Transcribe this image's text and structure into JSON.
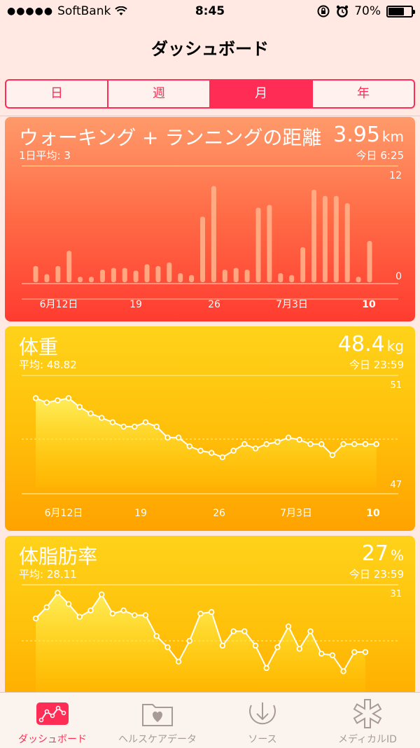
{
  "status": {
    "carrier": "SoftBank",
    "time": "8:45",
    "battery": "70%",
    "battery_level": 0.7
  },
  "nav": {
    "title": "ダッシュボード"
  },
  "segments": [
    {
      "label": "日",
      "active": false
    },
    {
      "label": "週",
      "active": false
    },
    {
      "label": "月",
      "active": true
    },
    {
      "label": "年",
      "active": false
    }
  ],
  "cards": {
    "distance": {
      "title": "ウォーキング + ランニングの距離",
      "value": "3.95",
      "unit": "km",
      "sub": "1日平均: 3",
      "time": "今日 6:25"
    },
    "weight": {
      "title": "体重",
      "value": "48.4",
      "unit": "kg",
      "sub": "平均: 48.82",
      "time": "今日 23:59"
    },
    "fat": {
      "title": "体脂肪率",
      "value": "27",
      "unit": "%",
      "sub": "平均: 28.11",
      "time": "今日 23:59"
    }
  },
  "chart_data": [
    {
      "type": "bar",
      "x_ticks": [
        "6月12日",
        "19",
        "26",
        "7月3日",
        "10"
      ],
      "y_ticks": [
        "12",
        "0"
      ],
      "ylim": [
        0,
        12
      ],
      "values": [
        1.8,
        0.9,
        1.8,
        3.5,
        0.6,
        0.6,
        1.4,
        1.6,
        1.6,
        1.3,
        2.0,
        1.8,
        2.2,
        1.0,
        0.8,
        7.3,
        10.7,
        1.4,
        1.6,
        1.4,
        8.3,
        8.6,
        1.0,
        0.8,
        3.9,
        10.3,
        9.6,
        9.6,
        8.8,
        0.6,
        4.6
      ]
    },
    {
      "type": "area",
      "x_ticks": [
        "6月12日",
        "19",
        "26",
        "7月3日",
        "10"
      ],
      "y_ticks": [
        "51",
        "47"
      ],
      "ylim": [
        47,
        51
      ],
      "values": [
        50.6,
        50.4,
        50.5,
        50.6,
        50.2,
        49.9,
        49.7,
        49.5,
        49.3,
        49.3,
        49.5,
        49.3,
        48.8,
        48.8,
        48.4,
        48.2,
        48.1,
        47.9,
        48.2,
        48.5,
        48.3,
        48.5,
        48.6,
        48.8,
        48.7,
        48.5,
        48.5,
        48.0,
        48.5,
        48.5,
        48.5,
        48.5
      ]
    },
    {
      "type": "area",
      "x_ticks": [
        "6月12日",
        "19",
        "26",
        "7月3日",
        "10"
      ],
      "y_ticks": [
        "31"
      ],
      "ylim": [
        24,
        31
      ],
      "values": [
        28.9,
        29.6,
        30.5,
        29.8,
        29.0,
        29.4,
        30.4,
        29.2,
        29.4,
        29.1,
        29.1,
        27.8,
        27.1,
        26.2,
        27.5,
        29.2,
        29.3,
        27.2,
        28.1,
        28.1,
        27.2,
        25.8,
        27.1,
        28.4,
        27.0,
        28.1,
        26.7,
        26.6,
        25.6,
        26.8,
        26.8
      ]
    }
  ],
  "colors": {
    "accent": "#ff2d55",
    "distance_top": "#ff9a6a",
    "distance_bottom": "#ff3b30",
    "weight_top": "#ffd21a",
    "weight_bottom": "#ffa200",
    "grid_line": "#fff3b0"
  },
  "tabs": [
    {
      "label": "ダッシュボード",
      "icon": "dashboard-icon",
      "active": true
    },
    {
      "label": "ヘルスケアデータ",
      "icon": "health-data-folder-icon",
      "active": false
    },
    {
      "label": "ソース",
      "icon": "sources-download-icon",
      "active": false
    },
    {
      "label": "メディカルID",
      "icon": "medical-id-star-icon",
      "active": false
    }
  ]
}
